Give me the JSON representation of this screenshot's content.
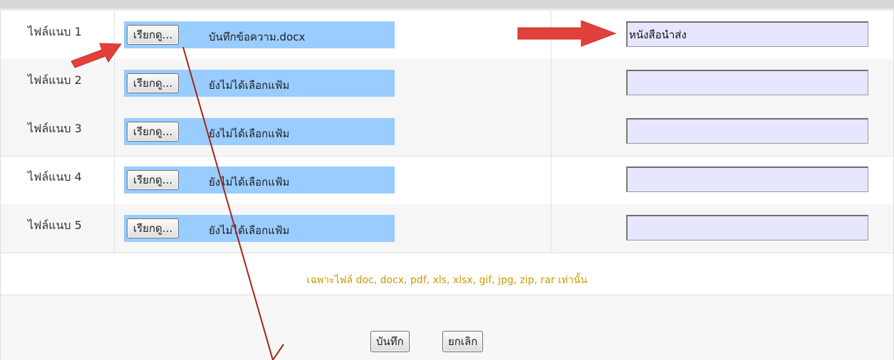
{
  "attachments": [
    {
      "label": "ไฟล์แนบ 1",
      "button": "เรียกดู...",
      "file_name": "บันทึกข้อความ.docx",
      "description": "หนังสือนำส่ง"
    },
    {
      "label": "ไฟล์แนบ 2",
      "button": "เรียกดู...",
      "file_name": "ยังไม่ได้เลือกแฟ้ม",
      "description": ""
    },
    {
      "label": "ไฟล์แนบ 3",
      "button": "เรียกดู...",
      "file_name": "ยังไม่ได้เลือกแฟ้ม",
      "description": ""
    },
    {
      "label": "ไฟล์แนบ 4",
      "button": "เรียกดู...",
      "file_name": "ยังไม่ได้เลือกแฟ้ม",
      "description": ""
    },
    {
      "label": "ไฟล์แนบ 5",
      "button": "เรียกดู...",
      "file_name": "ยังไม่ได้เลือกแฟ้ม",
      "description": ""
    }
  ],
  "note": "เฉพาะไฟล์ doc, docx, pdf, xls, xlsx, gif, jpg, zip, rar เท่านั้น",
  "actions": {
    "save": "บันทึก",
    "cancel": "ยกเลิก"
  },
  "colors": {
    "file_box": "#99ccff",
    "input_bg": "#e6e6ff",
    "note": "#cc9900",
    "arrow": "#e2403a",
    "line": "#a32616"
  },
  "icons": {
    "annotation_arrow": "red-arrow-icon"
  }
}
